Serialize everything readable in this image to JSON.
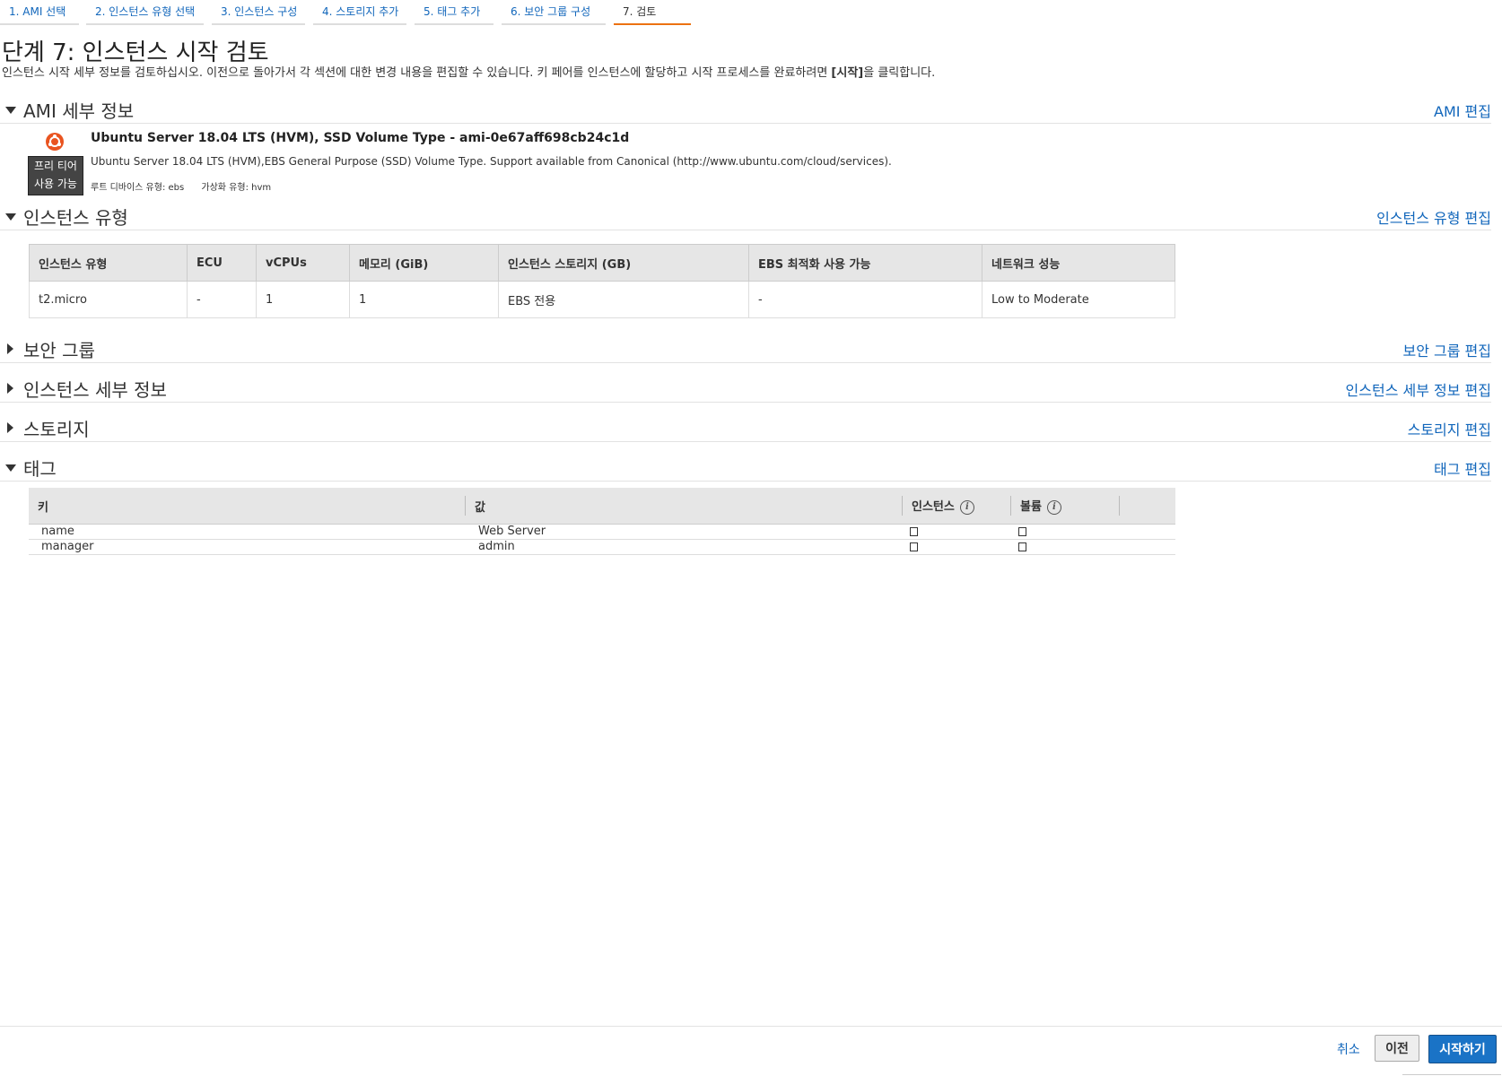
{
  "tabs": [
    {
      "label": "1. AMI 선택"
    },
    {
      "label": "2. 인스턴스 유형 선택"
    },
    {
      "label": "3. 인스턴스 구성"
    },
    {
      "label": "4. 스토리지 추가"
    },
    {
      "label": "5. 태그 추가"
    },
    {
      "label": "6. 보안 그룹 구성"
    },
    {
      "label": "7. 검토"
    }
  ],
  "page": {
    "title": "단계 7: 인스턴스 시작 검토",
    "desc_before": "인스턴스 시작 세부 정보를 검토하십시오. 이전으로 돌아가서 각 섹션에 대한 변경 내용을 편집할 수 있습니다. 키 페어를 인스턴스에 할당하고 시작 프로세스를 완료하려면 ",
    "desc_bold": "[시작]",
    "desc_after": "을 클릭합니다."
  },
  "sections": {
    "ami": {
      "title": "AMI 세부 정보",
      "edit": "AMI 편집"
    },
    "instance_type": {
      "title": "인스턴스 유형",
      "edit": "인스턴스 유형 편집"
    },
    "security_group": {
      "title": "보안 그룹",
      "edit": "보안 그룹 편집"
    },
    "instance_details": {
      "title": "인스턴스 세부 정보",
      "edit": "인스턴스 세부 정보 편집"
    },
    "storage": {
      "title": "스토리지",
      "edit": "스토리지 편집"
    },
    "tags": {
      "title": "태그",
      "edit": "태그 편집"
    }
  },
  "ami": {
    "free_tier_line1": "프리 티어",
    "free_tier_line2": "사용 가능",
    "name": "Ubuntu Server 18.04 LTS (HVM), SSD Volume Type - ami-0e67aff698cb24c1d",
    "description": "Ubuntu Server 18.04 LTS (HVM),EBS General Purpose (SSD) Volume Type. Support available from Canonical (http://www.ubuntu.com/cloud/services).",
    "root_device": "루트 디바이스 유형: ebs",
    "virtualization": "가상화 유형: hvm",
    "icon": "ubuntu-logo-icon",
    "brand_color": "#e95420"
  },
  "instance_table": {
    "headers": [
      "인스턴스 유형",
      "ECU",
      "vCPUs",
      "메모리 (GiB)",
      "인스턴스 스토리지 (GB)",
      "EBS 최적화 사용 가능",
      "네트워크 성능"
    ],
    "row": [
      "t2.micro",
      "-",
      "1",
      "1",
      "EBS 전용",
      "-",
      "Low to Moderate"
    ]
  },
  "tag_table": {
    "headers": [
      "키",
      "값",
      "인스턴스",
      "볼륨"
    ],
    "rows": [
      {
        "key": "name",
        "value": "Web Server"
      },
      {
        "key": "manager",
        "value": "admin"
      }
    ]
  },
  "footer": {
    "cancel": "취소",
    "previous": "이전",
    "launch": "시작하기"
  },
  "colors": {
    "link": "#1166bb",
    "primary_button": "#1a73c6",
    "active_tab_underline": "#ec7211"
  }
}
